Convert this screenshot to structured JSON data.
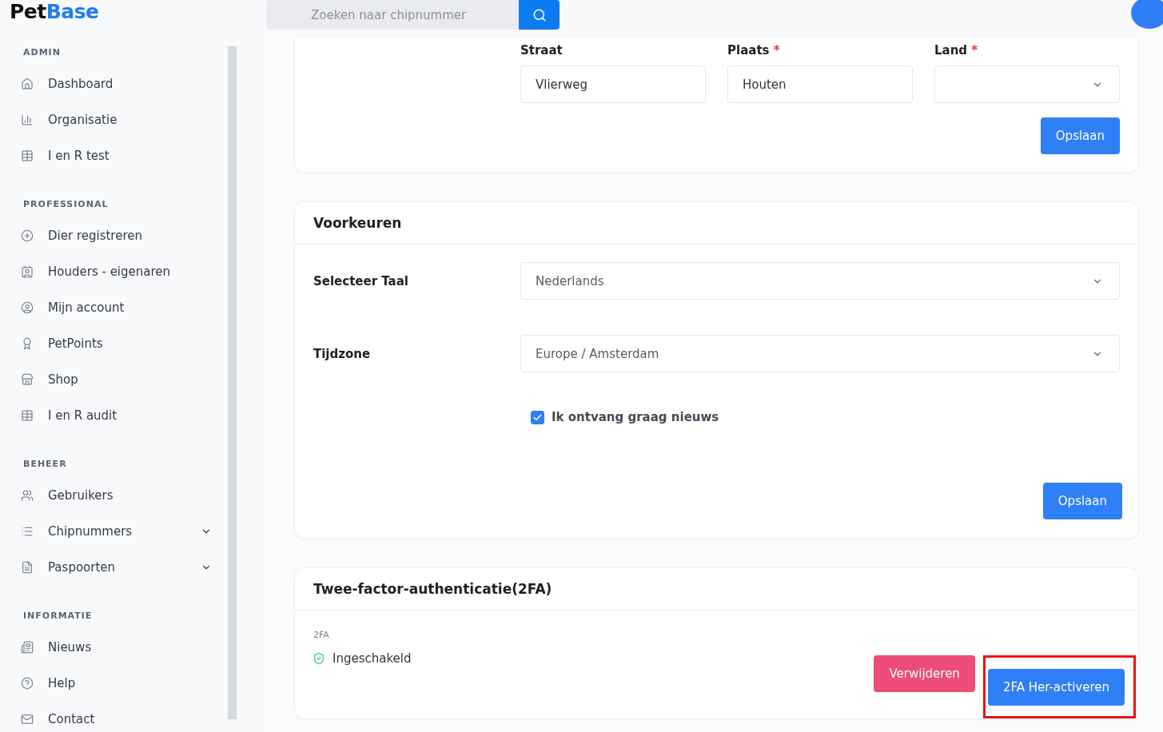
{
  "brand": {
    "name": "Pet",
    "accent": "Base"
  },
  "search": {
    "placeholder": "Zoeken naar chipnummer"
  },
  "sidebar": {
    "sections": [
      {
        "title": "ADMIN",
        "items": [
          {
            "label": "Dashboard",
            "kind": "link"
          },
          {
            "label": "Organisatie",
            "kind": "link"
          },
          {
            "label": "I en R test",
            "kind": "link"
          }
        ]
      },
      {
        "title": "PROFESSIONAL",
        "items": [
          {
            "label": "Dier registreren",
            "kind": "link"
          },
          {
            "label": "Houders - eigenaren",
            "kind": "link"
          },
          {
            "label": "Mijn account",
            "kind": "link"
          },
          {
            "label": "PetPoints",
            "kind": "link"
          },
          {
            "label": "Shop",
            "kind": "link"
          },
          {
            "label": "I en R audit",
            "kind": "link"
          }
        ]
      },
      {
        "title": "BEHEER",
        "items": [
          {
            "label": "Gebruikers",
            "kind": "link"
          },
          {
            "label": "Chipnummers",
            "kind": "group",
            "expanded": false
          },
          {
            "label": "Paspoorten",
            "kind": "group",
            "expanded": false
          }
        ]
      },
      {
        "title": "INFORMATIE",
        "items": [
          {
            "label": "Nieuws",
            "kind": "link"
          },
          {
            "label": "Help",
            "kind": "link"
          },
          {
            "label": "Contact",
            "kind": "link"
          }
        ]
      }
    ]
  },
  "address_card": {
    "fields": [
      {
        "label": "Straat",
        "required": false,
        "kind": "text",
        "value": "Vlierweg"
      },
      {
        "label": "Plaats",
        "required": true,
        "kind": "text",
        "value": "Houten"
      },
      {
        "label": "Land",
        "required": true,
        "kind": "select"
      }
    ],
    "required_mark": "*",
    "save": "Opslaan"
  },
  "preferences": {
    "title": "Voorkeuren",
    "rows": [
      {
        "label": "Selecteer Taal",
        "value": "Nederlands"
      },
      {
        "label": "Tijdzone",
        "value": "Europe / Amsterdam"
      }
    ],
    "newsletter": {
      "label": "Ik ontvang graag nieuws",
      "checked": true
    },
    "save": "Opslaan"
  },
  "two_factor": {
    "title": "Twee-factor-authenticatie(2FA)",
    "caption": "2FA",
    "status": "Ingeschakeld",
    "enabled": true,
    "buttons": [
      {
        "label": "Verwijderen",
        "kind": "danger",
        "highlighted": false
      },
      {
        "label": "2FA Her-activeren",
        "kind": "primary",
        "highlighted": true
      }
    ]
  }
}
